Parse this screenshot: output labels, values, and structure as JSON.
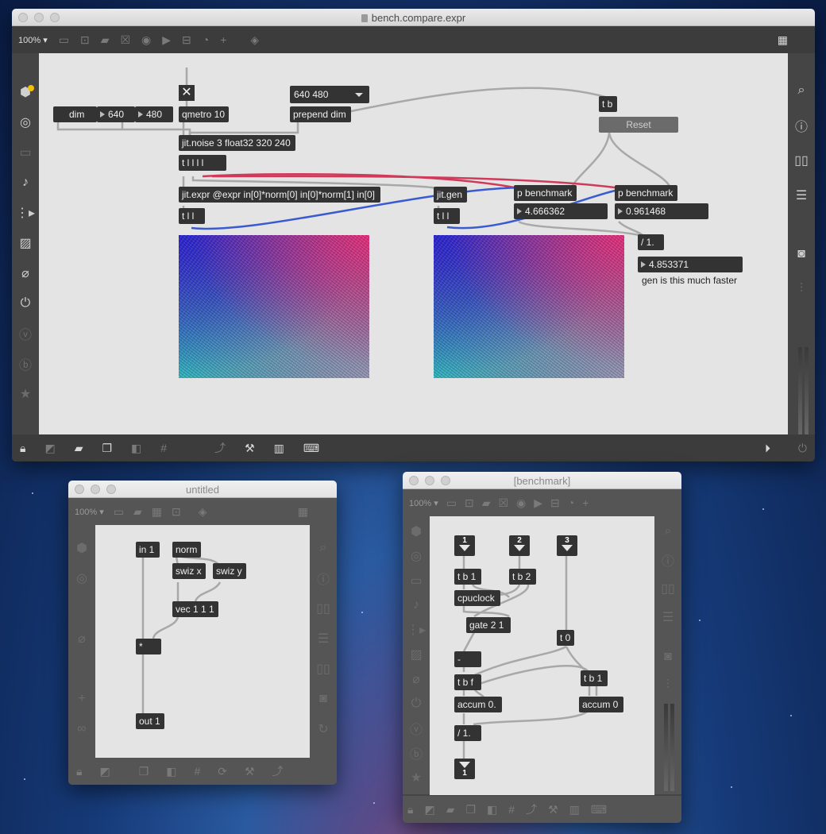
{
  "main_window": {
    "title": "bench.compare.expr",
    "zoom": "100%",
    "objects": {
      "dim_msg": "dim",
      "num_width": "640",
      "num_height": "480",
      "toggle_symbol": "✕",
      "qmetro": "qmetro 10",
      "umenu_value": "640 480",
      "prepend": "prepend dim",
      "tb_reset": "t b",
      "reset_button": "Reset",
      "jit_noise": "jit.noise 3 float32 320 240",
      "t_llll": "t l l l l",
      "jit_expr": "jit.expr @expr in[0]*norm[0] in[0]*norm[1] in[0]",
      "jit_gen": "jit.gen",
      "p_bench_1": "p benchmark",
      "p_bench_2": "p benchmark",
      "t_ll_1": "t l l",
      "t_ll_2": "t l l",
      "num_expr_time": "4.666362",
      "num_gen_time": "0.961468",
      "div": "/ 1.",
      "num_ratio": "4.853371",
      "comment_faster": "gen is this much faster"
    }
  },
  "untitled_window": {
    "title": "untitled",
    "zoom": "100%",
    "objects": {
      "in1": "in 1",
      "norm": "norm",
      "swiz_x": "swiz x",
      "swiz_y": "swiz y",
      "vec": "vec 1 1 1",
      "mult": "*",
      "out1": "out 1"
    }
  },
  "benchmark_window": {
    "title": "[benchmark]",
    "zoom": "100%",
    "objects": {
      "inlet1": "1",
      "inlet2": "2",
      "inlet3": "3",
      "tb1": "t b 1",
      "tb2": "t b 2",
      "cpuclock": "cpuclock",
      "gate": "gate 2 1",
      "t0": "t 0",
      "minus": "-",
      "tbf": "t b f",
      "tb1b": "t b 1",
      "accum_f": "accum 0.",
      "accum_i": "accum 0",
      "div": "/ 1.",
      "outlet1": "1"
    }
  },
  "colors": {
    "canvas": "#e4e4e4",
    "object": "#333333",
    "cord_gray": "#a8a8a8",
    "cord_red": "#d03a5a",
    "cord_blue": "#3a5ad0",
    "window_chrome": "#454545"
  },
  "icons": {
    "main_left_sidebar": [
      "cube-icon",
      "target-icon",
      "window-icon",
      "music-note-icon",
      "sequence-icon",
      "image-icon",
      "paperclip-icon",
      "plug-icon",
      "vimeo-icon",
      "bug-icon",
      "star-icon"
    ],
    "main_right_sidebar": [
      "search-icon",
      "info-icon",
      "book-icon",
      "list-icon",
      "camera-icon",
      "mixer-icon"
    ],
    "main_bottom_toolbar": [
      "lock-icon",
      "presentation-icon",
      "comment-icon",
      "layers-icon",
      "mute-icon",
      "grid-icon",
      "patchcord-icon",
      "wrench-icon",
      "piano-icon",
      "keyboard-icon",
      "play-icon",
      "power-icon"
    ]
  }
}
